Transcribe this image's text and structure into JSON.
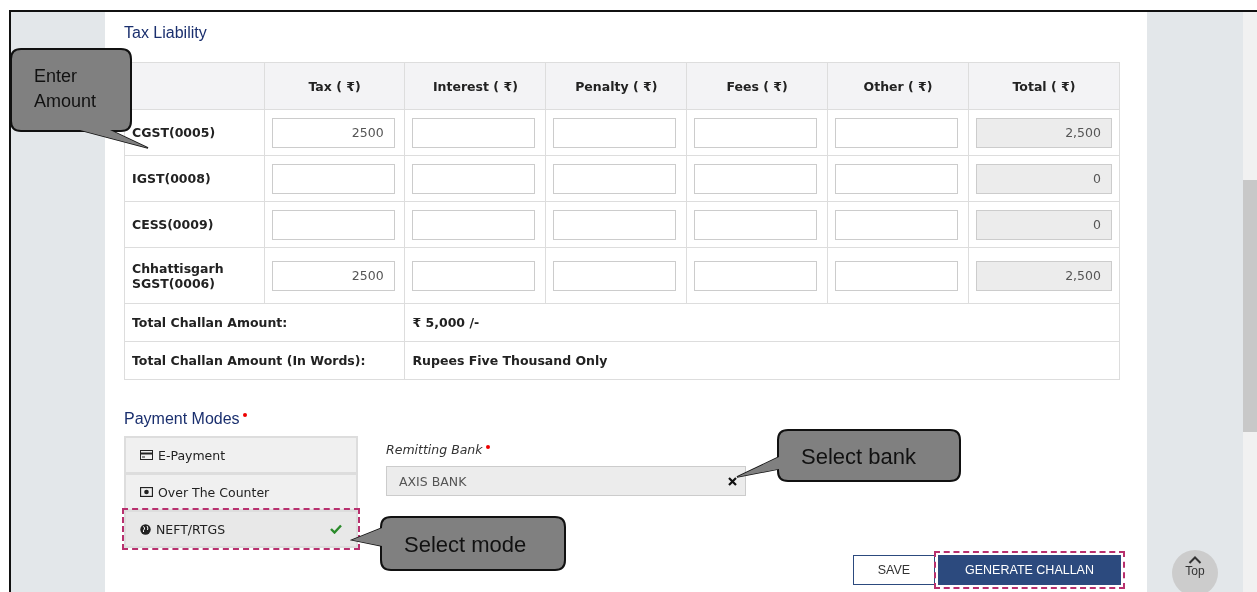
{
  "section_title": "Tax Liability",
  "table": {
    "columns": [
      "Tax ( ₹)",
      "Interest ( ₹)",
      "Penalty ( ₹)",
      "Fees ( ₹)",
      "Other ( ₹)",
      "Total ( ₹)"
    ],
    "rows": [
      {
        "name": "CGST(0005)",
        "tax": "2500",
        "total": "2,500"
      },
      {
        "name": "IGST(0008)",
        "total": "0"
      },
      {
        "name": "CESS(0009)",
        "total": "0"
      },
      {
        "name": "Chhattisgarh SGST(0006)",
        "tax": "2500",
        "total": "2,500"
      }
    ],
    "summary": [
      {
        "label": "Total Challan Amount:",
        "value": "₹ 5,000 /-"
      },
      {
        "label": "Total Challan Amount (In Words):",
        "value": "Rupees Five Thousand Only"
      }
    ]
  },
  "payment": {
    "title": "Payment Modes",
    "modes": [
      {
        "label": "E-Payment",
        "kind": "card",
        "selected": false
      },
      {
        "label": "Over The Counter",
        "kind": "cash",
        "selected": false
      },
      {
        "label": "NEFT/RTGS",
        "kind": "globe",
        "selected": true
      }
    ],
    "bank_label": "Remitting Bank",
    "bank_value": "AXIS BANK"
  },
  "buttons": [
    {
      "label": "SAVE",
      "kind": "secondary",
      "highlighted": false
    },
    {
      "label": "GENERATE CHALLAN",
      "kind": "primary",
      "highlighted": true
    }
  ],
  "top_button": "Top",
  "callouts": [
    {
      "text": "Enter Amount"
    },
    {
      "text": "Select bank"
    },
    {
      "text": "Select mode"
    }
  ]
}
